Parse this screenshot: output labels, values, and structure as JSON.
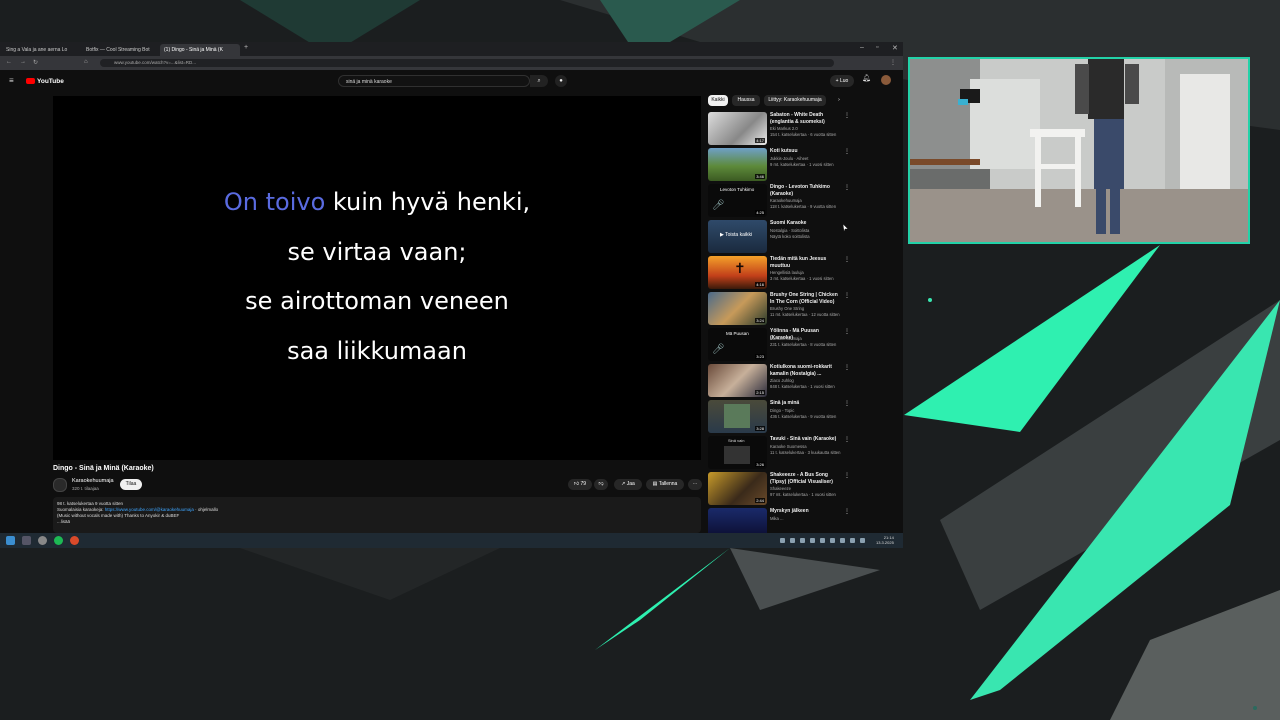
{
  "browser": {
    "tabs": [
      {
        "label": "Sing a Vala ja ane aerna Lo"
      },
      {
        "label": "Botfix — Cool Streaming Bot"
      },
      {
        "label": "(1) Dingo - Sinä ja Minä (K"
      }
    ],
    "url": "www.youtube.com/watch?v=...&list=RD..."
  },
  "youtube": {
    "logo": "YouTube",
    "search_query": "sinä ja minä karaoke",
    "create_label": "Luo",
    "lyrics": {
      "line1_highlight": "On toivo",
      "line1_rest": " kuin hyvä henki,",
      "line2": "se virtaa vaan;",
      "line3": "se airottoman veneen",
      "line4": "saa liikkumaan"
    },
    "video_title": "Dingo - Sinä ja Minä (Karaoke)",
    "channel": {
      "name": "Karaokehuumaja",
      "subs": "320 t. tilaajaa",
      "join_label": "Tilaa"
    },
    "actions": {
      "likes": "79",
      "share": "Jaa",
      "save": "Tallenna"
    },
    "description": {
      "line1": "98 t. katselukertaa  9 vuotta sitten",
      "line2_prefix": "Suomalaisia karaokeja: ",
      "line2_link": "https://www.youtube.com/@karaokehuumaja",
      "line2_suffix": " · ohjelmallo",
      "line3": "(Music without vocals made with) Thanks to Anyokir & duBEF",
      "line4": "...lisää"
    },
    "chips": [
      "Kaikki",
      "Haussa",
      "Liittyy: Karaokehuumaja"
    ],
    "recommendations": [
      {
        "title": "Sabaton - White Death (englantia & suomeksi)",
        "channel": "Eki Markus 2.0",
        "meta": "154 t. katselukertaa · 6 vuotta sitten",
        "duration": "4:17"
      },
      {
        "title": "Koti kutsuu",
        "channel": "Jukkis-Joulu · Aiheet",
        "meta": "9 mt. katselukertaa · 1 vuosi sitten",
        "duration": "3:46"
      },
      {
        "title": "Dingo - Levoton Tuhkimo (Karaoke)",
        "channel": "Karaokehuumaja",
        "meta": "118 t. katselukertaa · 9 vuotta sitten",
        "duration": "4:25"
      },
      {
        "title": "Suomi Karaoke",
        "channel": "Nostalgia · Soittolista",
        "meta": "Näytä koko soittolista",
        "duration": ""
      },
      {
        "title": "Tiedän mitä kun Jeesus muuttuu",
        "channel": "Hengellisiä lauluja",
        "meta": "3 mt. katselukertaa · 1 vuosi sitten",
        "duration": "4:16"
      },
      {
        "title": "Brushy One String | Chicken In The Corn (Official Video)",
        "channel": "Brushy One String",
        "meta": "11 mt. katselukertaa · 12 vuotta sitten",
        "duration": "3:24"
      },
      {
        "title": "Yölinna - Mä Puusan (Karaoke)",
        "channel": "Karaokehuumaja",
        "meta": "231 t. katselukertaa · 8 vuotta sitten",
        "duration": "3:23"
      },
      {
        "title": "Kotiulkona suomi-rokkarit kamalin (Nostalgia) ...",
        "channel": "Ziaco Juhlog",
        "meta": "848 t. katselukertaa · 1 vuosi sitten",
        "duration": "2:15"
      },
      {
        "title": "Sinä ja minä",
        "channel": "Dingo - Topic",
        "meta": "436 t. katselukertaa · 9 vuotta sitten",
        "duration": "3:28"
      },
      {
        "title": "Tavuki - Sinä vain (Karaoke)",
        "channel": "Karaoke Suomessa",
        "meta": "11 t. katselukertaa · 3 kuukautta sitten",
        "duration": "3:26"
      },
      {
        "title": "Shakeeeze - A Bus Song (Tipsy) (Official Visualiser)",
        "channel": "Shakeeeze",
        "meta": "97 mt. katselukertaa · 1 vuosi sitten",
        "duration": "2:44"
      },
      {
        "title": "Myrskyn jälkeen",
        "channel": "Mika ...",
        "meta": "",
        "duration": ""
      }
    ]
  },
  "taskbar": {
    "time": "21:14",
    "date": "13.3.2025"
  },
  "colors": {
    "accent_teal": "#23d2a8",
    "lyric_highlight": "#5a6be0",
    "youtube_red": "#ff0000"
  }
}
